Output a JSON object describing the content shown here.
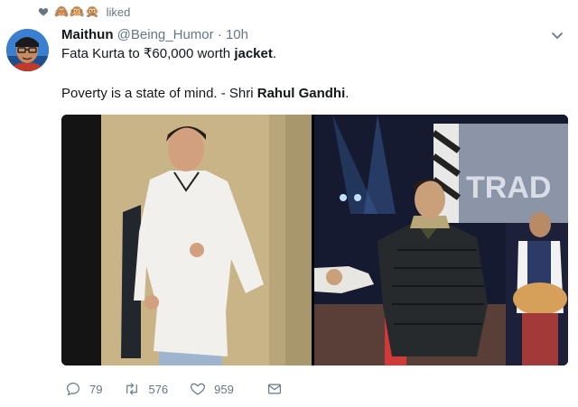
{
  "activity": {
    "emoji_text": "🙈🙉🙊",
    "liked_label": "liked"
  },
  "tweet": {
    "display_name": "Maithun",
    "handle": "@Being_Humor",
    "separator": "·",
    "timestamp": "10h",
    "line1_prefix": "Fata Kurta to ₹60,000 worth ",
    "line1_bold": "jacket",
    "line1_suffix": ".",
    "line2_prefix": "Poverty is a state of mind. - Shri ",
    "line2_bold": "Rahul Gandhi",
    "line2_suffix": "."
  },
  "media": {
    "right_sign_text": "TRAD"
  },
  "actions": {
    "reply_count": "79",
    "retweet_count": "576",
    "like_count": "959"
  },
  "colors": {
    "text_primary": "#14171a",
    "text_secondary": "#657786"
  }
}
